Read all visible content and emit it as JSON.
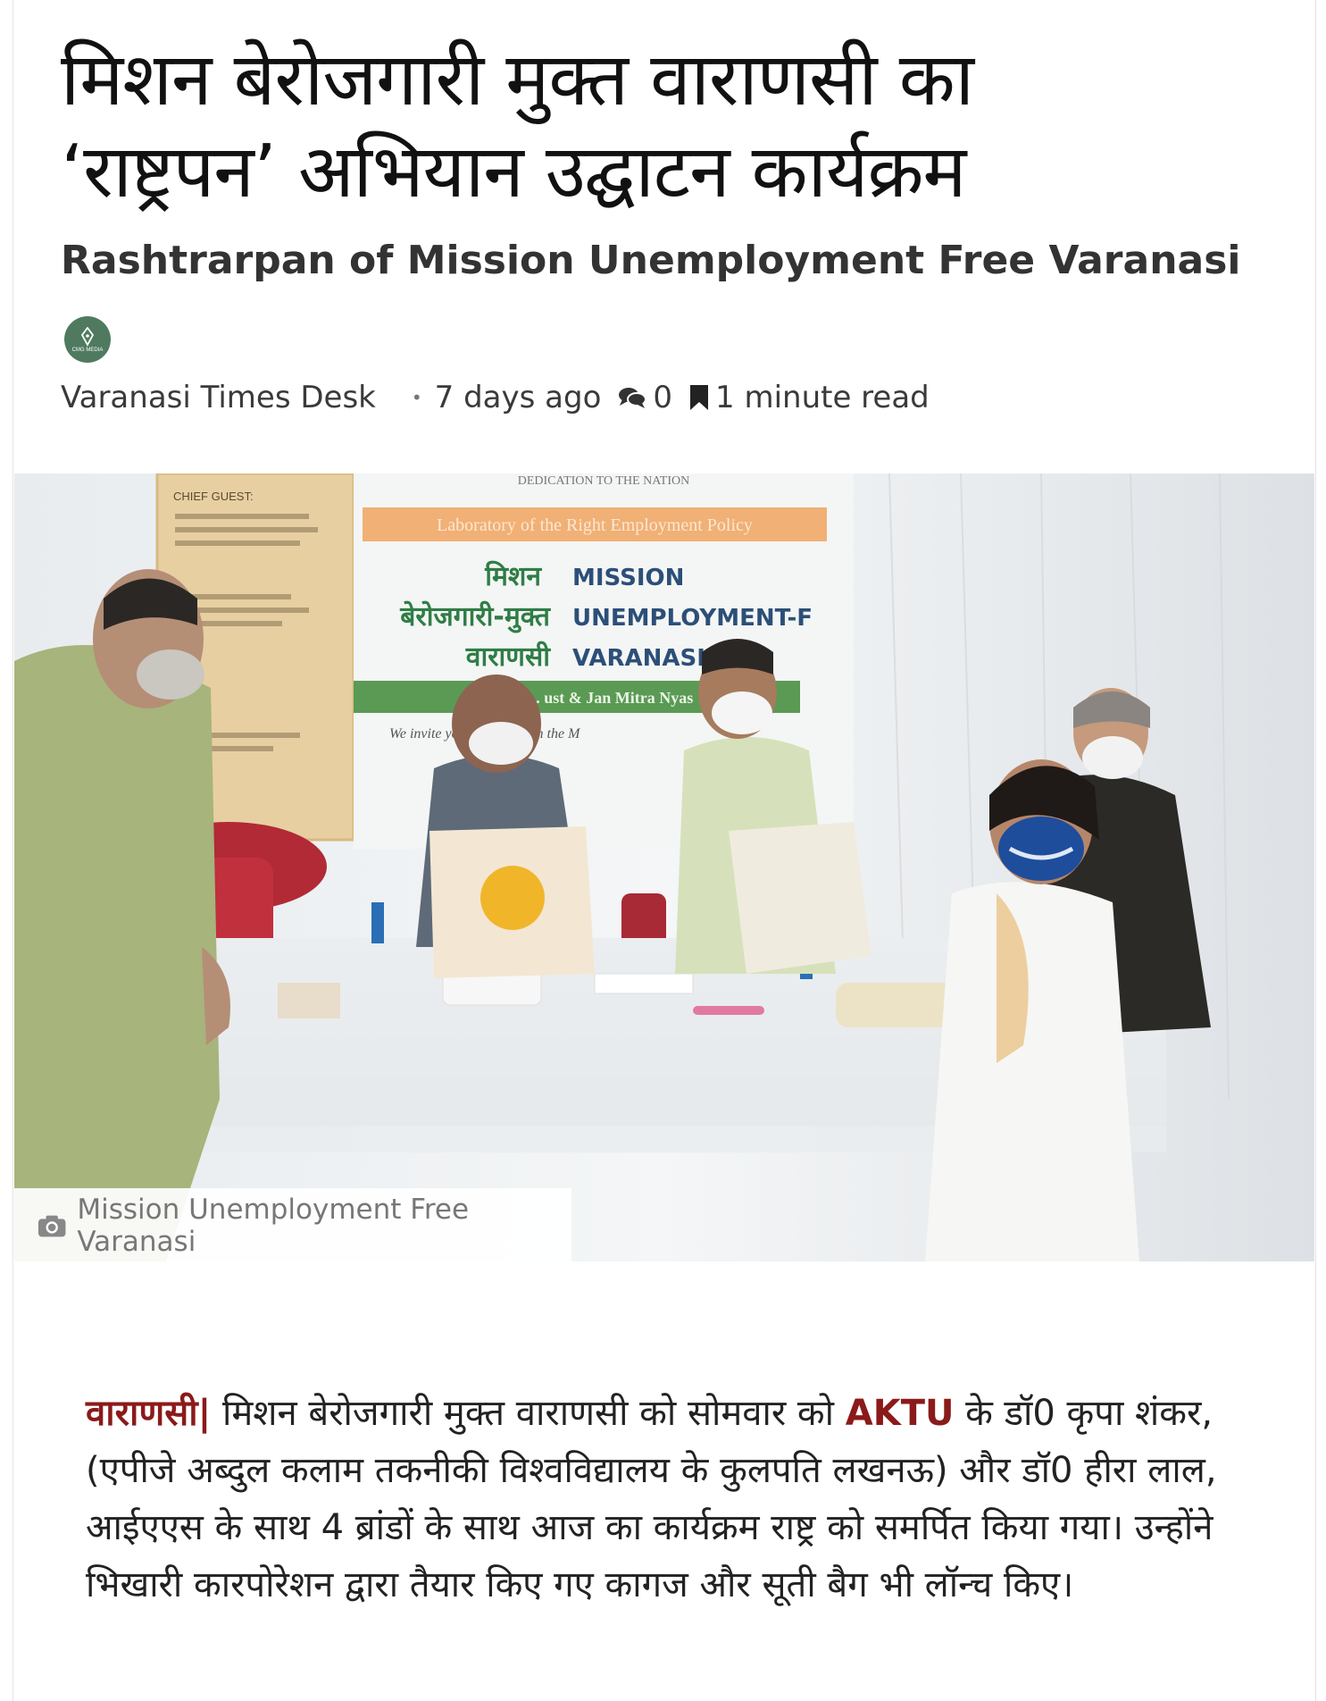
{
  "article": {
    "title": "मिशन बेरोजगारी मुक्त वाराणसी का ‘राष्ट्रपन’ अभियान उद्घाटन कार्यक्रम",
    "subtitle": "Rashtrarpan of Mission Unemployment Free Varanasi",
    "author": "Varanasi Times Desk",
    "date": "7 days ago",
    "comments_count": "0",
    "read_time": "1 minute read",
    "avatar_label": "CMG MEDIA"
  },
  "photo": {
    "caption": "Mission Unemployment Free Varanasi",
    "banner_top": "DEDICATION TO THE NATION",
    "chief_guest_label": "CHIEF GUEST:",
    "orange_strip": "Laboratory of the Right Employment Policy",
    "mission_hi_1": "मिशन",
    "mission_en_1": "MISSION",
    "mission_hi_2": "बेरोजगारी-मुक्त",
    "mission_en_2": "UNEMPLOYMENT-F",
    "mission_hi_3": "वाराणसी",
    "mission_en_3": "VARANASI",
    "green_strip": "Common ... ust & Jan Mitra Nyas",
    "invite_line": "We invite you ... strengthen the M"
  },
  "body": {
    "place": "वाराणसी|",
    "text_1": " मिशन बेरोजगारी मुक्त वाराणसी को सोमवार को ",
    "org": "AKTU",
    "text_2": " के डॉ0 कृपा शंकर, (एपीजे अब्दुल कलाम तकनीकी विश्वविद्यालय के कुलपति लखनऊ) और डॉ0 हीरा लाल, आईएएस के साथ 4 ब्रांडों के साथ आज का कार्यक्रम राष्ट्र को समर्पित किया गया। उन्होंने भिखारी कारपोरेशन द्वारा तैयार किए गए कागज और सूती बैग भी लॉन्च किए।"
  },
  "colors": {
    "accent": "#8b1a1a",
    "avatar": "#4f7a5f",
    "banner_green": "#5a9a54",
    "banner_orange": "#f0a35e"
  }
}
